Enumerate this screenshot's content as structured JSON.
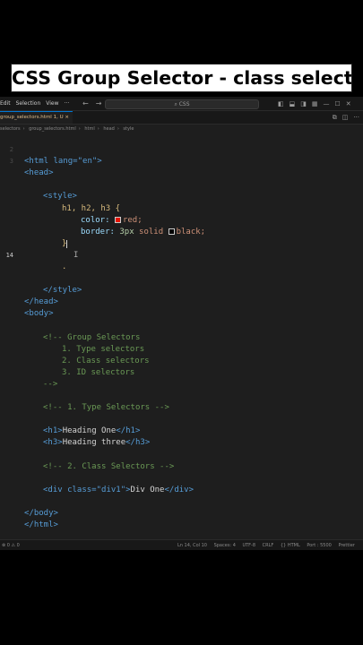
{
  "caption": "CSS Group Selector - class selector",
  "titlebar": {
    "menu": [
      "Edit",
      "Selection",
      "View",
      "···"
    ],
    "search": "CSS",
    "nav_back": "←",
    "nav_forward": "→"
  },
  "tab": {
    "filename": "group_selectors.html",
    "badge": "1, U",
    "close": "×"
  },
  "breadcrumb": [
    "selectors",
    "group_selectors.html",
    "html",
    "head",
    "style"
  ],
  "code": {
    "line_numbers": [
      "2",
      "3",
      "",
      "",
      "",
      "",
      "",
      "",
      "",
      "14",
      "",
      "",
      "",
      "",
      "",
      "",
      "",
      "",
      "",
      "",
      "",
      "",
      "",
      "",
      "",
      "",
      "",
      "",
      "",
      "",
      "",
      ""
    ],
    "lines": {
      "l1": "<html lang=\"en\">",
      "l2": "<head>",
      "l3": "<style>",
      "l4": "h1, h2, h3 {",
      "l5_prop": "color:",
      "l5_val": "red;",
      "l6_prop": "border:",
      "l6_num": "3px",
      "l6_rest": "solid",
      "l6_val": "black;",
      "l7": "}",
      "l8": ".",
      "l9": "</style>",
      "l10": "</head>",
      "l11": "<body>",
      "l12": "<!-- Group Selectors",
      "l13": "1. Type selectors",
      "l14": "2. Class selectors",
      "l15": "3. ID selectors",
      "l16": "-->",
      "l17": "<!-- 1. Type Selectors -->",
      "l18_open": "<h1>",
      "l18_text": "Heading One",
      "l18_close": "</h1>",
      "l19_open": "<h3>",
      "l19_text": "Heading three",
      "l19_close": "</h3>",
      "l20": "<!-- 2. Class Selectors -->",
      "l21_open": "<div class=\"div1\">",
      "l21_text": "Div One",
      "l21_close": "</div>",
      "l22": "</body>",
      "l23": "</html>"
    }
  },
  "statusbar": {
    "left": "⊗ 0  ⚠ 0",
    "right": [
      "Ln 14, Col 10",
      "Spaces: 4",
      "UTF-8",
      "CRLF",
      "{} HTML",
      "Port : 5500",
      "Prettier"
    ]
  },
  "colors": {
    "accent": "#0078d4",
    "swatch_red": "#e51400",
    "swatch_black": "#000000"
  }
}
